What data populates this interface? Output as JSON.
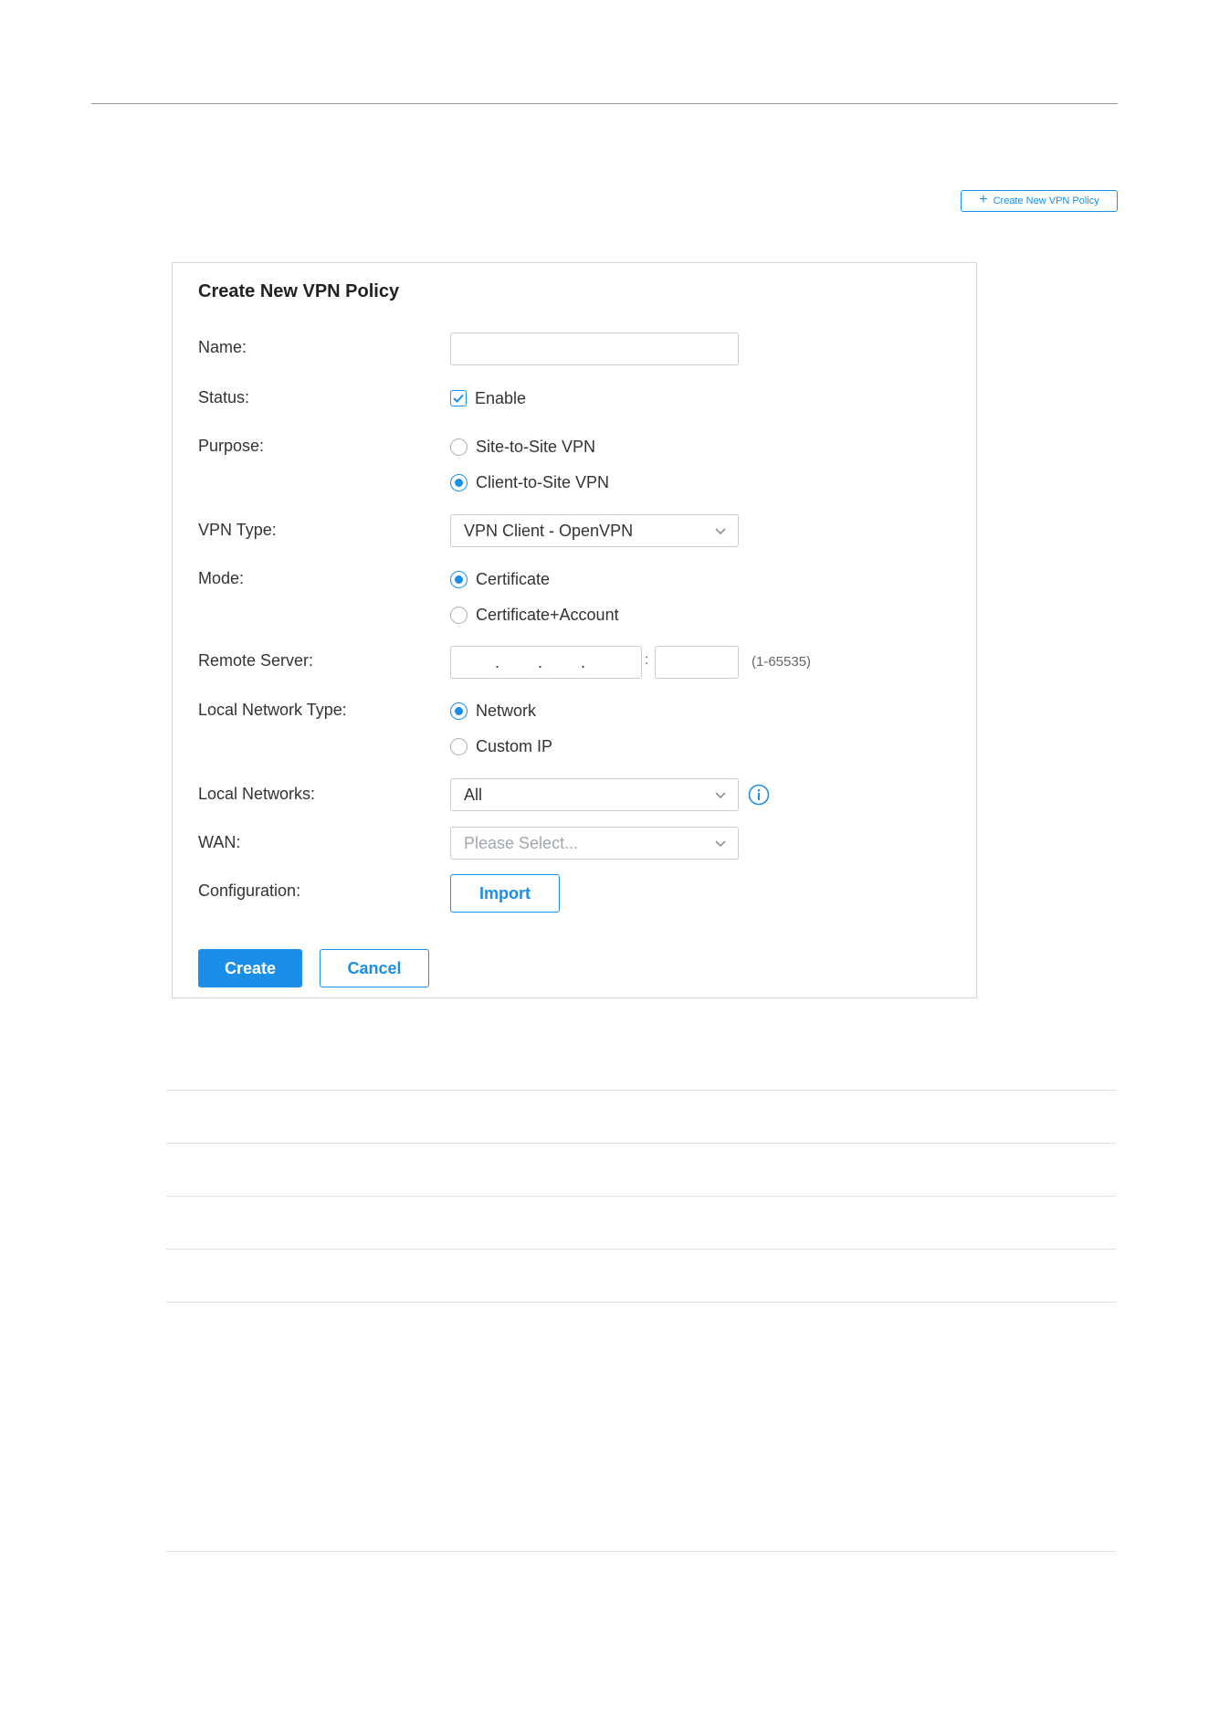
{
  "header": {
    "create_new_button_label": "Create New VPN Policy"
  },
  "form": {
    "title": "Create New VPN Policy",
    "name": {
      "label": "Name:",
      "value": ""
    },
    "status": {
      "label": "Status:",
      "checkbox_label": "Enable",
      "checked": true
    },
    "purpose": {
      "label": "Purpose:",
      "options": [
        {
          "label": "Site-to-Site VPN",
          "selected": false
        },
        {
          "label": "Client-to-Site VPN",
          "selected": true
        }
      ]
    },
    "vpn_type": {
      "label": "VPN Type:",
      "value": "VPN Client - OpenVPN"
    },
    "mode": {
      "label": "Mode:",
      "options": [
        {
          "label": "Certificate",
          "selected": true
        },
        {
          "label": "Certificate+Account",
          "selected": false
        }
      ]
    },
    "remote_server": {
      "label": "Remote Server:",
      "ip_separators": [
        ".",
        ".",
        "."
      ],
      "port_separator": ":",
      "port_hint": "(1-65535)"
    },
    "local_network_type": {
      "label": "Local Network Type:",
      "options": [
        {
          "label": "Network",
          "selected": true
        },
        {
          "label": "Custom IP",
          "selected": false
        }
      ]
    },
    "local_networks": {
      "label": "Local Networks:",
      "value": "All"
    },
    "wan": {
      "label": "WAN:",
      "placeholder": "Please Select..."
    },
    "configuration": {
      "label": "Configuration:",
      "button_label": "Import"
    },
    "create_label": "Create",
    "cancel_label": "Cancel"
  },
  "colors": {
    "accent": "#1b8ee8",
    "border": "#c8cdd2",
    "rule": "#dce3ea"
  },
  "icons": [
    "plus-icon",
    "check-icon",
    "chevron-down-icon",
    "info-icon"
  ]
}
